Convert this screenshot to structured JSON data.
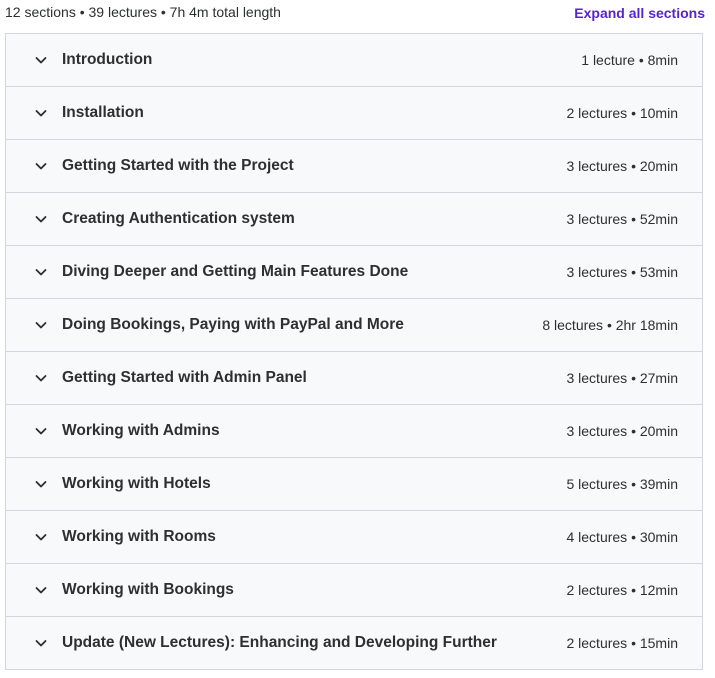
{
  "summary": {
    "text": "12 sections • 39 lectures • 7h 4m total length",
    "expand_label": "Expand all sections",
    "accent_color": "#5624d0"
  },
  "sections": [
    {
      "title": "Introduction",
      "meta": "1 lecture • 8min"
    },
    {
      "title": "Installation",
      "meta": "2 lectures • 10min"
    },
    {
      "title": "Getting Started with the Project",
      "meta": "3 lectures • 20min"
    },
    {
      "title": "Creating Authentication system",
      "meta": "3 lectures • 52min"
    },
    {
      "title": "Diving Deeper and Getting Main Features Done",
      "meta": "3 lectures • 53min"
    },
    {
      "title": "Doing Bookings, Paying with PayPal and More",
      "meta": "8 lectures • 2hr 18min"
    },
    {
      "title": "Getting Started with Admin Panel",
      "meta": "3 lectures • 27min"
    },
    {
      "title": "Working with Admins",
      "meta": "3 lectures • 20min"
    },
    {
      "title": "Working with Hotels",
      "meta": "5 lectures • 39min"
    },
    {
      "title": "Working with Rooms",
      "meta": "4 lectures • 30min"
    },
    {
      "title": "Working with Bookings",
      "meta": "2 lectures • 12min"
    },
    {
      "title": "Update (New Lectures): Enhancing and Developing Further",
      "meta": "2 lectures • 15min"
    }
  ],
  "icons": {
    "chevron": "chevron-down-icon"
  }
}
